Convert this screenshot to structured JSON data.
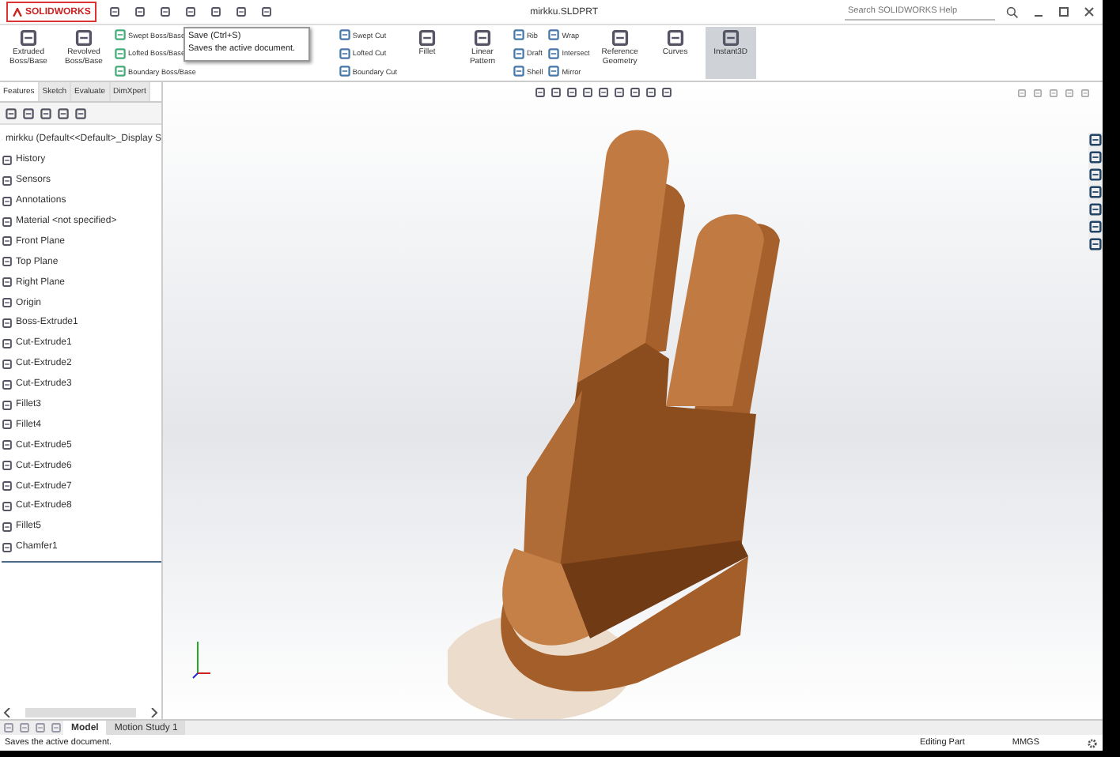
{
  "title_bar": {
    "logo": "SOLIDWORKS",
    "document": "mirkku.SLDPRT",
    "help_search": {
      "placeholder": "Search SOLIDWORKS Help"
    }
  },
  "ribbon": {
    "large": [
      "Extruded Boss/Base",
      "Revolved Boss/Base"
    ],
    "boss_column": [
      "Swept Boss/Base",
      "Lofted Boss/Base",
      "Boundary Boss/Base"
    ],
    "cut_column": [
      "Swept Cut",
      "Lofted Cut",
      "Boundary Cut"
    ],
    "feature_large": [
      "Fillet",
      "Linear Pattern"
    ],
    "rib_column": [
      "Rib",
      "Draft",
      "Shell"
    ],
    "wrap_column": [
      "Wrap",
      "Intersect",
      "Mirror"
    ],
    "more": [
      "Reference Geometry",
      "Curves"
    ],
    "instant3d": {
      "label": "Instant3D",
      "on": true
    }
  },
  "tooltip": {
    "title": "Save  (Ctrl+S)",
    "text": "Saves the active document."
  },
  "tabs": [
    {
      "label": "Features",
      "selected": true
    },
    {
      "label": "Sketch",
      "selected": false
    },
    {
      "label": "Evaluate",
      "selected": false
    },
    {
      "label": "DimXpert",
      "selected": false
    }
  ],
  "tree": {
    "root": "mirkku (Default<<Default>_Display S",
    "items": [
      "History",
      "Sensors",
      "Annotations",
      "Material <not specified>",
      "Front Plane",
      "Top Plane",
      "Right Plane",
      "Origin",
      "Boss-Extrude1",
      "Cut-Extrude1",
      "Cut-Extrude2",
      "Cut-Extrude3",
      "Fillet3",
      "Fillet4",
      "Cut-Extrude5",
      "Cut-Extrude6",
      "Cut-Extrude7",
      "Cut-Extrude8",
      "Fillet5",
      "Chamfer1"
    ]
  },
  "bottom_tabs": [
    {
      "label": "Model",
      "selected": true
    },
    {
      "label": "Motion Study 1",
      "selected": false
    }
  ],
  "status_bar": {
    "message": "Saves the active document.",
    "mode": "Editing Part",
    "units": "MMGS"
  }
}
